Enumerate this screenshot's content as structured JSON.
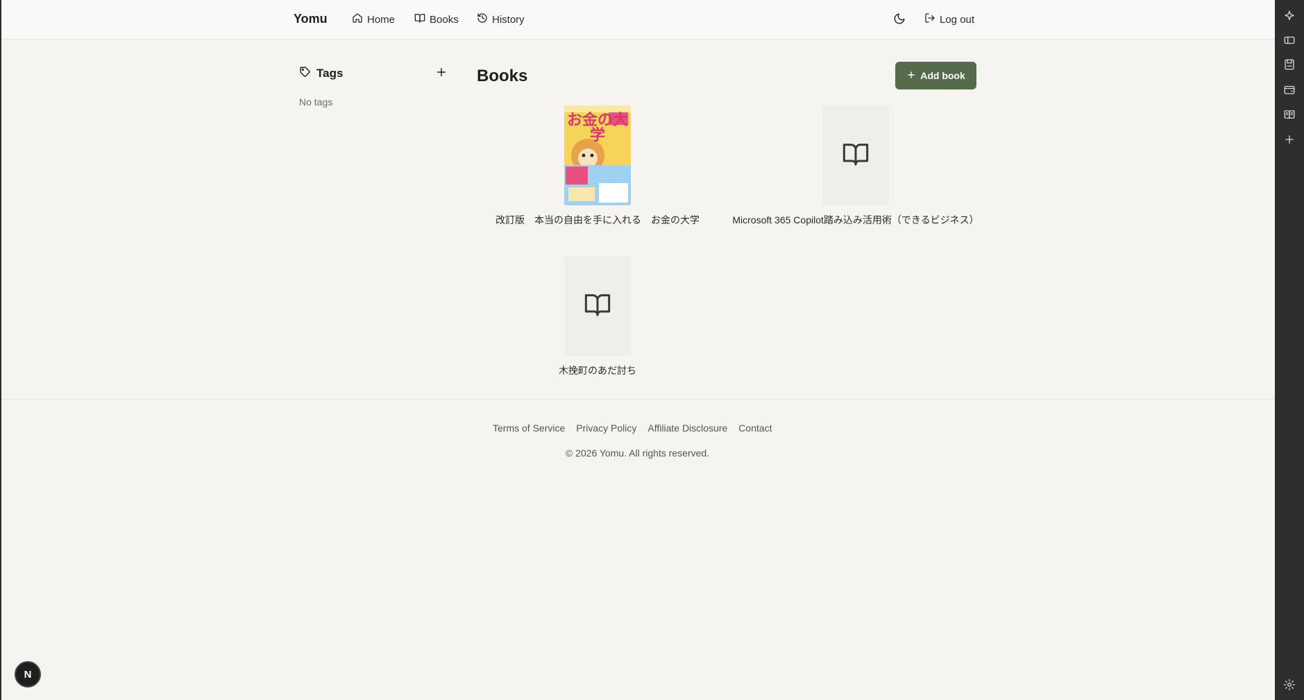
{
  "app": {
    "brand": "Yomu"
  },
  "nav": {
    "items": [
      {
        "label": "Home",
        "icon": "home-icon"
      },
      {
        "label": "Books",
        "icon": "book-open-icon"
      },
      {
        "label": "History",
        "icon": "history-icon"
      }
    ],
    "theme_icon": "moon-icon",
    "logout_label": "Log out"
  },
  "sidebar": {
    "title": "Tags",
    "empty_text": "No tags"
  },
  "main": {
    "title": "Books",
    "add_label": "Add book",
    "books": [
      {
        "title": "改訂版　本当の自由を手に入れる　お金の大学",
        "cover": "image",
        "cover_text": "お金の大学"
      },
      {
        "title": "Microsoft 365 Copilot踏み込み活用術（できるビジネス）",
        "cover": "placeholder"
      },
      {
        "title": "木挽町のあだ討ち",
        "cover": "placeholder"
      }
    ]
  },
  "footer": {
    "links": [
      "Terms of Service",
      "Privacy Policy",
      "Affiliate Disclosure",
      "Contact"
    ],
    "copyright": "© 2026 Yomu. All rights reserved."
  },
  "avatar": {
    "initial": "N"
  },
  "colors": {
    "accent": "#566b4c",
    "background": "#f6f4f0",
    "rail": "#2e2e2e"
  }
}
